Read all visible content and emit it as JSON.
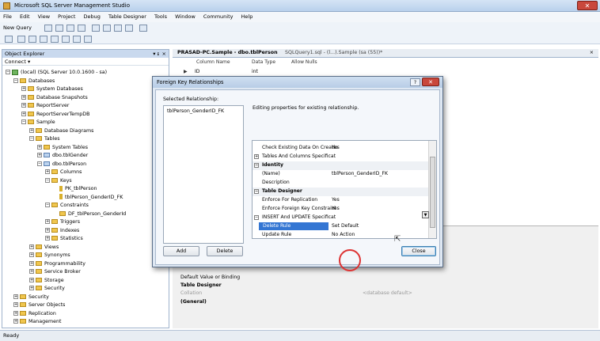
{
  "window": {
    "title": "Microsoft SQL Server Management Studio",
    "close_glyph": "✕"
  },
  "menu": [
    "File",
    "Edit",
    "View",
    "Project",
    "Debug",
    "Table Designer",
    "Tools",
    "Window",
    "Community",
    "Help"
  ],
  "toolbar": {
    "new_query": "New Query"
  },
  "object_explorer": {
    "title": "Object Explorer",
    "connect": "Connect ▾",
    "pin": "▾ ᵻ",
    "close": "×",
    "tree": [
      {
        "label": "(local) (SQL Server 10.0.1600 - sa)",
        "indent": 0,
        "icon": "server",
        "exp": "−"
      },
      {
        "label": "Databases",
        "indent": 1,
        "icon": "folder",
        "exp": "−"
      },
      {
        "label": "System Databases",
        "indent": 2,
        "icon": "folder",
        "exp": "+"
      },
      {
        "label": "Database Snapshots",
        "indent": 2,
        "icon": "folder",
        "exp": "+"
      },
      {
        "label": "ReportServer",
        "indent": 2,
        "icon": "folder",
        "exp": "+"
      },
      {
        "label": "ReportServerTempDB",
        "indent": 2,
        "icon": "folder",
        "exp": "+"
      },
      {
        "label": "Sample",
        "indent": 2,
        "icon": "folder",
        "exp": "−"
      },
      {
        "label": "Database Diagrams",
        "indent": 3,
        "icon": "folder",
        "exp": "+"
      },
      {
        "label": "Tables",
        "indent": 3,
        "icon": "folder",
        "exp": "−"
      },
      {
        "label": "System Tables",
        "indent": 4,
        "icon": "folder",
        "exp": "+"
      },
      {
        "label": "dbo.tblGender",
        "indent": 4,
        "icon": "table",
        "exp": "+"
      },
      {
        "label": "dbo.tblPerson",
        "indent": 4,
        "icon": "table",
        "exp": "−"
      },
      {
        "label": "Columns",
        "indent": 5,
        "icon": "folder",
        "exp": "+"
      },
      {
        "label": "Keys",
        "indent": 5,
        "icon": "folder",
        "exp": "−"
      },
      {
        "label": "PK_tblPerson",
        "indent": 6,
        "icon": "key",
        "exp": ""
      },
      {
        "label": "tblPerson_GenderID_FK",
        "indent": 6,
        "icon": "key",
        "exp": ""
      },
      {
        "label": "Constraints",
        "indent": 5,
        "icon": "folder",
        "exp": "−"
      },
      {
        "label": "DF_tblPerson_GenderId",
        "indent": 6,
        "icon": "folder",
        "exp": ""
      },
      {
        "label": "Triggers",
        "indent": 5,
        "icon": "folder",
        "exp": "+"
      },
      {
        "label": "Indexes",
        "indent": 5,
        "icon": "folder",
        "exp": "+"
      },
      {
        "label": "Statistics",
        "indent": 5,
        "icon": "folder",
        "exp": "+"
      },
      {
        "label": "Views",
        "indent": 3,
        "icon": "folder",
        "exp": "+"
      },
      {
        "label": "Synonyms",
        "indent": 3,
        "icon": "folder",
        "exp": "+"
      },
      {
        "label": "Programmability",
        "indent": 3,
        "icon": "folder",
        "exp": "+"
      },
      {
        "label": "Service Broker",
        "indent": 3,
        "icon": "folder",
        "exp": "+"
      },
      {
        "label": "Storage",
        "indent": 3,
        "icon": "folder",
        "exp": "+"
      },
      {
        "label": "Security",
        "indent": 3,
        "icon": "folder",
        "exp": "+"
      },
      {
        "label": "Security",
        "indent": 1,
        "icon": "folder",
        "exp": "+"
      },
      {
        "label": "Server Objects",
        "indent": 1,
        "icon": "folder",
        "exp": "+"
      },
      {
        "label": "Replication",
        "indent": 1,
        "icon": "folder",
        "exp": "+"
      },
      {
        "label": "Management",
        "indent": 1,
        "icon": "folder",
        "exp": "+"
      }
    ]
  },
  "tabs": {
    "active": "PRASAD-PC.Sample - dbo.tblPerson",
    "other": "SQLQuery1.sql - (l...).Sample (sa (55))*",
    "close": "×"
  },
  "designer": {
    "col_name": "Column Name",
    "data_type": "Data Type",
    "allow_nulls": "Allow Nulls",
    "row1_name": "ID",
    "row1_type": "int"
  },
  "properties": {
    "default_value": "Default Value or Binding",
    "table_designer": "Table Designer",
    "collation": "Collation",
    "collation_value": "<database default>",
    "general": "(General)"
  },
  "dialog": {
    "title": "Foreign Key Relationships",
    "help": "?",
    "close": "✕",
    "selected_label": "Selected Relationship:",
    "selected_item": "tblPerson_GenderID_FK",
    "editing_text": "Editing properties for existing relationship.",
    "add": "Add",
    "delete": "Delete",
    "close_button": "Close",
    "grid": [
      {
        "type": "prop",
        "name": "Check Existing Data On Creatio",
        "value": "Yes",
        "box": ""
      },
      {
        "type": "prop",
        "name": "Tables And Columns Specificat",
        "value": "",
        "box": "+"
      },
      {
        "type": "cat",
        "name": "Identity",
        "value": "",
        "box": "−"
      },
      {
        "type": "prop",
        "name": "(Name)",
        "value": "tblPerson_GenderID_FK",
        "box": ""
      },
      {
        "type": "prop",
        "name": "Description",
        "value": "",
        "box": ""
      },
      {
        "type": "cat",
        "name": "Table Designer",
        "value": "",
        "box": "−"
      },
      {
        "type": "prop",
        "name": "Enforce For Replication",
        "value": "Yes",
        "box": ""
      },
      {
        "type": "prop",
        "name": "Enforce Foreign Key Constraint",
        "value": "Yes",
        "box": ""
      },
      {
        "type": "prop",
        "name": "INSERT And UPDATE Specificat",
        "value": "",
        "box": "−"
      },
      {
        "type": "sel",
        "name": "Delete Rule",
        "value": "Set Default",
        "box": ""
      },
      {
        "type": "prop",
        "name": "Update Rule",
        "value": "No Action",
        "box": ""
      }
    ]
  },
  "status": "Ready"
}
